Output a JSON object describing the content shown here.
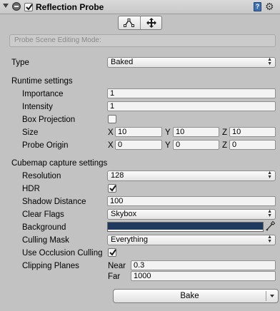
{
  "header": {
    "title": "Reflection Probe",
    "enabled": true
  },
  "toolbar": {
    "edit_mode_placeholder": "Probe Scene Editing Mode:"
  },
  "type": {
    "label": "Type",
    "value": "Baked"
  },
  "runtime": {
    "heading": "Runtime settings",
    "importance": {
      "label": "Importance",
      "value": "1"
    },
    "intensity": {
      "label": "Intensity",
      "value": "1"
    },
    "box_projection": {
      "label": "Box Projection",
      "checked": false
    },
    "size": {
      "label": "Size",
      "x_label": "X",
      "x": "10",
      "y_label": "Y",
      "y": "10",
      "z_label": "Z",
      "z": "10"
    },
    "origin": {
      "label": "Probe Origin",
      "x_label": "X",
      "x": "0",
      "y_label": "Y",
      "y": "0",
      "z_label": "Z",
      "z": "0"
    }
  },
  "cubemap": {
    "heading": "Cubemap capture settings",
    "resolution": {
      "label": "Resolution",
      "value": "128"
    },
    "hdr": {
      "label": "HDR",
      "checked": true
    },
    "shadow_distance": {
      "label": "Shadow Distance",
      "value": "100"
    },
    "clear_flags": {
      "label": "Clear Flags",
      "value": "Skybox"
    },
    "background": {
      "label": "Background",
      "color": "#1f3a5e"
    },
    "culling_mask": {
      "label": "Culling Mask",
      "value": "Everything"
    },
    "occlusion": {
      "label": "Use Occlusion Culling",
      "checked": true
    },
    "clipping": {
      "label": "Clipping Planes",
      "near_label": "Near",
      "near": "0.3",
      "far_label": "Far",
      "far": "1000"
    }
  },
  "bake": {
    "label": "Bake"
  }
}
